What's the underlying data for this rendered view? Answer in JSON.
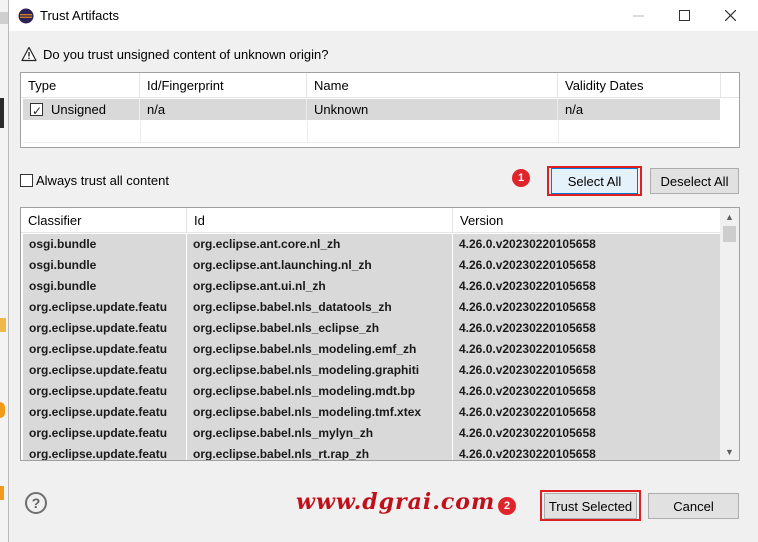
{
  "window": {
    "title": "Trust Artifacts",
    "minimize_icon": "minimize-icon",
    "maximize_icon": "maximize-icon",
    "close_icon": "close-icon"
  },
  "question": {
    "text": "Do you trust unsigned content of unknown origin?",
    "icon": "warning-icon"
  },
  "signer_table": {
    "columns": [
      "Type",
      "Id/Fingerprint",
      "Name",
      "Validity Dates"
    ],
    "rows": [
      {
        "type": "Unsigned",
        "checked": true,
        "id": "n/a",
        "name": "Unknown",
        "validity": "n/a"
      }
    ]
  },
  "always_trust": {
    "label": "Always trust all content",
    "checked": false
  },
  "buttons": {
    "select_all": "Select All",
    "deselect_all": "Deselect All",
    "trust_selected": "Trust Selected",
    "cancel": "Cancel"
  },
  "annotations": {
    "badge1": "1",
    "badge2": "2",
    "color": "#e0242c"
  },
  "artifacts_table": {
    "columns": [
      "Classifier",
      "Id",
      "Version"
    ],
    "rows": [
      {
        "classifier": "osgi.bundle",
        "id": "org.eclipse.ant.core.nl_zh",
        "version": "4.26.0.v20230220105658"
      },
      {
        "classifier": "osgi.bundle",
        "id": "org.eclipse.ant.launching.nl_zh",
        "version": "4.26.0.v20230220105658"
      },
      {
        "classifier": "osgi.bundle",
        "id": "org.eclipse.ant.ui.nl_zh",
        "version": "4.26.0.v20230220105658"
      },
      {
        "classifier": "org.eclipse.update.featu",
        "id": "org.eclipse.babel.nls_datatools_zh",
        "version": "4.26.0.v20230220105658"
      },
      {
        "classifier": "org.eclipse.update.featu",
        "id": "org.eclipse.babel.nls_eclipse_zh",
        "version": "4.26.0.v20230220105658"
      },
      {
        "classifier": "org.eclipse.update.featu",
        "id": "org.eclipse.babel.nls_modeling.emf_zh",
        "version": "4.26.0.v20230220105658"
      },
      {
        "classifier": "org.eclipse.update.featu",
        "id": "org.eclipse.babel.nls_modeling.graphiti",
        "version": "4.26.0.v20230220105658"
      },
      {
        "classifier": "org.eclipse.update.featu",
        "id": "org.eclipse.babel.nls_modeling.mdt.bp",
        "version": "4.26.0.v20230220105658"
      },
      {
        "classifier": "org.eclipse.update.featu",
        "id": "org.eclipse.babel.nls_modeling.tmf.xtex",
        "version": "4.26.0.v20230220105658"
      },
      {
        "classifier": "org.eclipse.update.featu",
        "id": "org.eclipse.babel.nls_mylyn_zh",
        "version": "4.26.0.v20230220105658"
      },
      {
        "classifier": "org.eclipse.update.featu",
        "id": "org.eclipse.babel.nls_rt.rap_zh",
        "version": "4.26.0.v20230220105658"
      }
    ]
  },
  "help_icon": "help-icon",
  "watermark": "www.dgrai.com"
}
